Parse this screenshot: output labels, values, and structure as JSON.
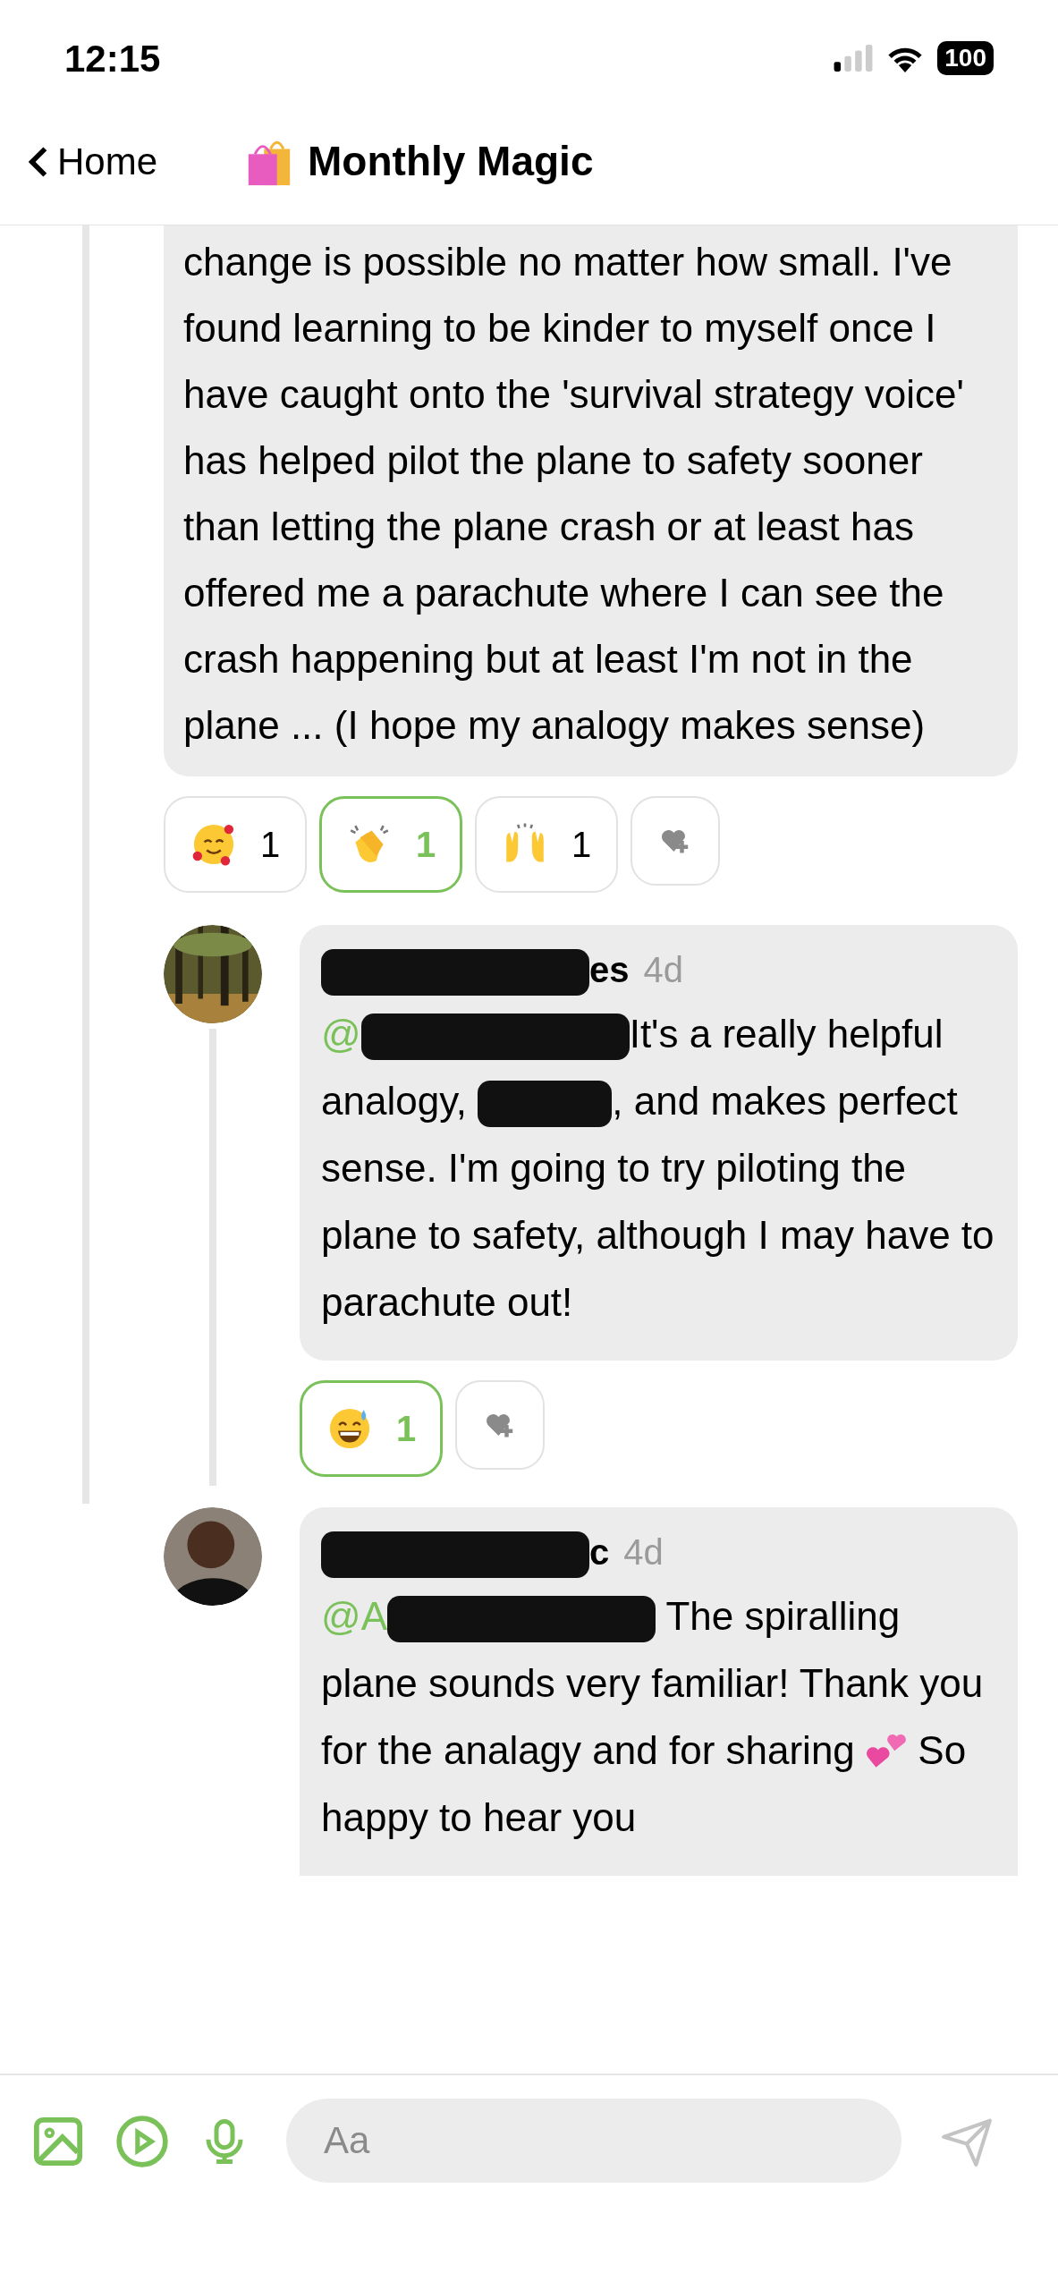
{
  "status_bar": {
    "time": "12:15",
    "battery": "100"
  },
  "header": {
    "back": "Home",
    "title": "Monthly Magic"
  },
  "post": {
    "body": "change is possible no matter how small. I've found learning to be kinder to myself once I have caught onto the 'survival strategy voice' has helped pilot the plane to safety sooner than letting the plane crash or at least has offered me a parachute where I can see the crash happening but at least I'm not in the plane ... (I hope my analogy makes sense)",
    "reactions": [
      {
        "kind": "hearts-face",
        "count": "1",
        "selected": false
      },
      {
        "kind": "clapping",
        "count": "1",
        "selected": true
      },
      {
        "kind": "raised-hands",
        "count": "1",
        "selected": false
      }
    ]
  },
  "replies": [
    {
      "avatar": {
        "kind": "picture"
      },
      "author": [
        {
          "kind": "redacted-long"
        },
        {
          "kind": "text",
          "text": "es"
        }
      ],
      "time": "4d",
      "body": [
        {
          "kind": "mention",
          "text": "@"
        },
        {
          "kind": "redacted-long"
        },
        {
          "kind": "text",
          "text": "It's a really helpful analogy, "
        },
        {
          "kind": "redacted-short"
        },
        {
          "kind": "text",
          "text": ", and makes perfect sense. I'm going to try piloting the plane to safety, although I may have to parachute out!"
        }
      ],
      "reactions": [
        {
          "kind": "sweat-smile",
          "count": "1",
          "selected": true
        }
      ]
    },
    {
      "avatar": {
        "kind": "person"
      },
      "author": [
        {
          "kind": "redacted-long"
        },
        {
          "kind": "text",
          "text": "c"
        }
      ],
      "time": "4d",
      "body": [
        {
          "kind": "mention",
          "text": "@A"
        },
        {
          "kind": "redacted-long"
        },
        {
          "kind": "text",
          "text": " The spiralling plane sounds very familiar! Thank you for the analagy and for sharing "
        },
        {
          "kind": "hearts"
        },
        {
          "kind": "text",
          "text": " So happy to hear you"
        }
      ]
    }
  ],
  "composer": {
    "placeholder": "Aa"
  }
}
